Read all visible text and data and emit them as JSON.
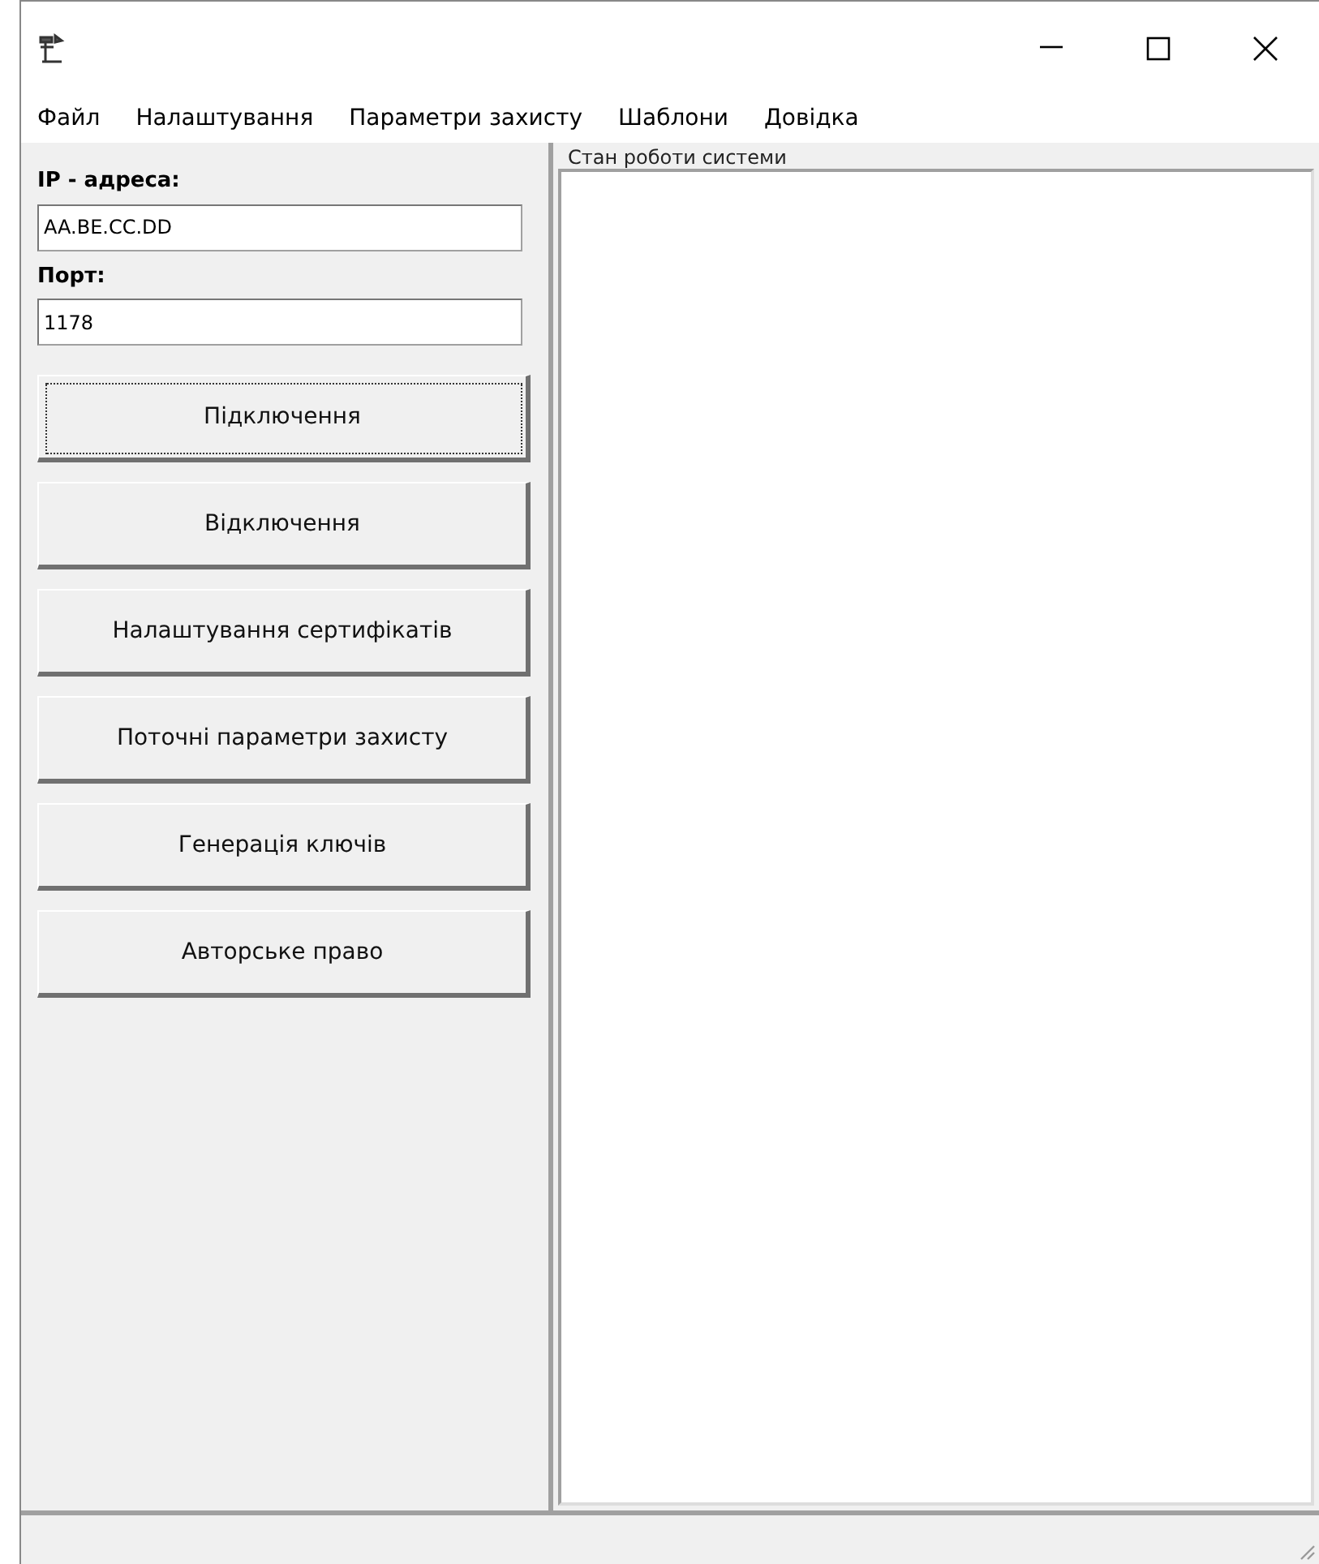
{
  "menu": [
    {
      "label": "Файл"
    },
    {
      "label": "Налаштування"
    },
    {
      "label": "Параметри захисту"
    },
    {
      "label": "Шаблони"
    },
    {
      "label": "Довідка"
    }
  ],
  "connection": {
    "ip_label": "IP - адреса:",
    "ip_value": "AA.BE.CC.DD",
    "port_label": "Порт:",
    "port_value": "1178"
  },
  "buttons": [
    {
      "label": "Підключення",
      "focused": true
    },
    {
      "label": "Відключення",
      "focused": false
    },
    {
      "label": "Налаштування сертифікатів",
      "focused": false
    },
    {
      "label": "Поточні параметри захисту",
      "focused": false
    },
    {
      "label": "Генерація ключів",
      "focused": false
    },
    {
      "label": "Авторське право",
      "focused": false
    }
  ],
  "log": {
    "title": "Стан роботи системи"
  }
}
